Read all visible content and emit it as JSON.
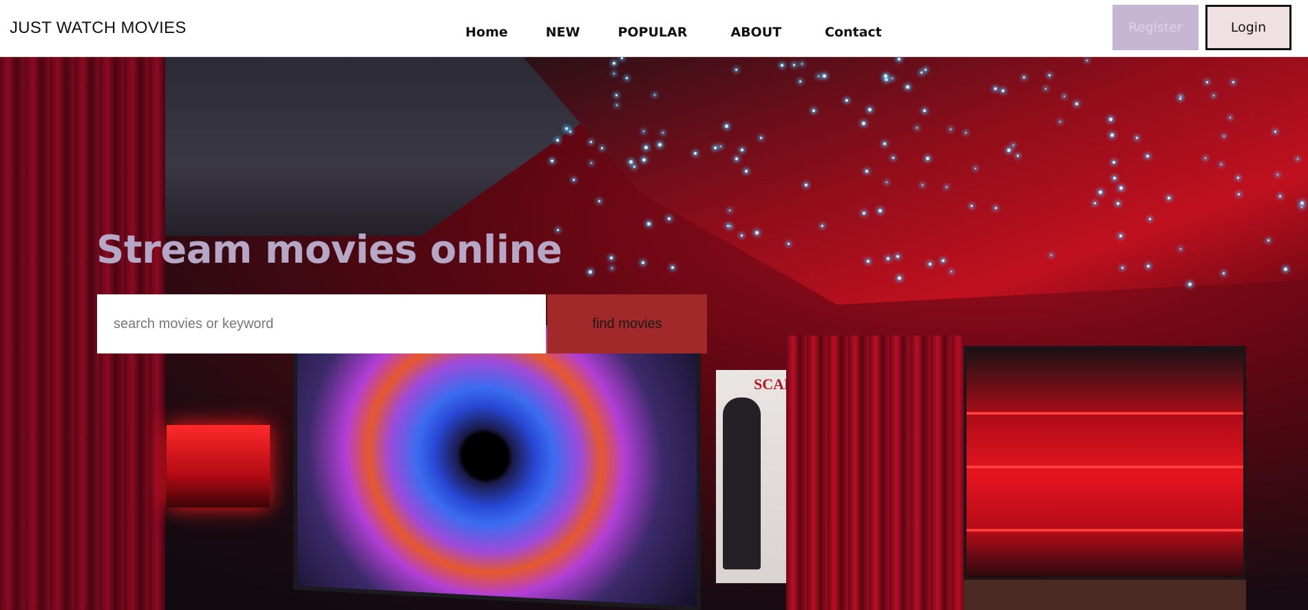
{
  "header": {
    "brand": "JUST WATCH MOVIES",
    "nav": [
      {
        "label": "Home"
      },
      {
        "label": "NEW"
      },
      {
        "label": "POPULAR"
      },
      {
        "label": "ABOUT"
      },
      {
        "label": "Contact"
      }
    ],
    "register_label": "Register",
    "login_label": "Login"
  },
  "hero": {
    "headline": "Stream movies online",
    "search": {
      "placeholder": "search movies or keyword",
      "value": ""
    },
    "find_button_label": "find movies",
    "poster_text": "SCARFA"
  },
  "colors": {
    "headline": "#b7a7c7",
    "register_bg": "#c7b6d3",
    "login_bg": "#efe1e3",
    "find_button_bg": "#a1292a",
    "header_bg": "#ffffff"
  }
}
